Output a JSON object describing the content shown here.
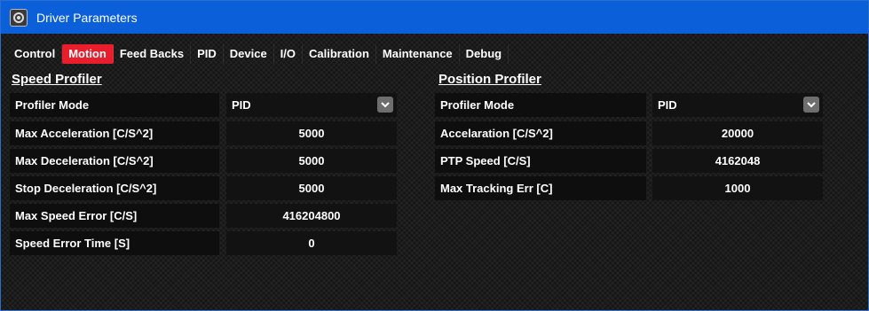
{
  "window": {
    "title": "Driver Parameters"
  },
  "tabs": [
    {
      "label": "Control"
    },
    {
      "label": "Motion"
    },
    {
      "label": "Feed Backs"
    },
    {
      "label": "PID"
    },
    {
      "label": "Device"
    },
    {
      "label": "I/O"
    },
    {
      "label": "Calibration"
    },
    {
      "label": "Maintenance"
    },
    {
      "label": "Debug"
    }
  ],
  "active_tab": "Motion",
  "colors": {
    "titlebar": "#0b5fd8",
    "active_tab": "#e81e2d"
  },
  "speed": {
    "title": "Speed Profiler",
    "profiler_mode": {
      "label": "Profiler Mode",
      "value": "PID"
    },
    "max_accel": {
      "label": "Max Acceleration [C/S^2]",
      "value": "5000"
    },
    "max_decel": {
      "label": "Max Deceleration [C/S^2]",
      "value": "5000"
    },
    "stop_decel": {
      "label": "Stop Deceleration [C/S^2]",
      "value": "5000"
    },
    "max_speed_err": {
      "label": "Max Speed Error [C/S]",
      "value": "416204800"
    },
    "speed_err_time": {
      "label": "Speed Error Time [S]",
      "value": "0"
    }
  },
  "position": {
    "title": "Position Profiler",
    "profiler_mode": {
      "label": "Profiler Mode",
      "value": "PID"
    },
    "accel": {
      "label": "Accelaration [C/S^2]",
      "value": "20000"
    },
    "ptp_speed": {
      "label": "PTP Speed [C/S]",
      "value": "4162048"
    },
    "max_track_err": {
      "label": "Max Tracking Err [C]",
      "value": "1000"
    }
  }
}
